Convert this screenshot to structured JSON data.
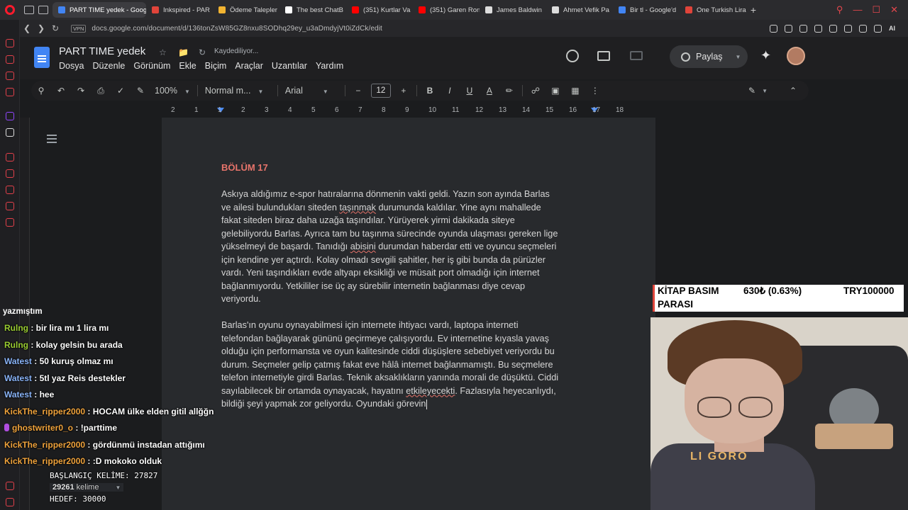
{
  "browser": {
    "tabs": [
      {
        "title": "PART TIME yedek - Google",
        "active": true,
        "color": "#4285f4"
      },
      {
        "title": "Inkspired - PAR",
        "color": "#e0443a"
      },
      {
        "title": "Ödeme Talepler",
        "color": "#f2b431"
      },
      {
        "title": "The best ChatB",
        "color": "#ffffff"
      },
      {
        "title": "(351) Kurtlar Va",
        "color": "#ff0000"
      },
      {
        "title": "(351) Garen Ron",
        "color": "#ff0000"
      },
      {
        "title": "James Baldwin",
        "color": "#dddddd"
      },
      {
        "title": "Ahmet Vefik Pa",
        "color": "#dddddd"
      },
      {
        "title": "Bir tl - Google'd",
        "color": "#4285f4"
      },
      {
        "title": "One Turkish Lira",
        "color": "#e0443a"
      }
    ],
    "new_tab_label": "+",
    "vpn_label": "VPN",
    "url": "docs.google.com/document/d/136tonZsW85GZ8nxu8SODhq29ey_u3aDmdyjVt0iZdCk/edit",
    "ai_label": "AI"
  },
  "docs": {
    "title": "PART TIME  yedek",
    "saving": "Kaydediliyor...",
    "menu": [
      "Dosya",
      "Düzenle",
      "Görünüm",
      "Ekle",
      "Biçim",
      "Araçlar",
      "Uzantılar",
      "Yardım"
    ],
    "share_label": "Paylaş",
    "toolbar": {
      "zoom": "100%",
      "style": "Normal m...",
      "font": "Arial",
      "font_size": "12"
    },
    "ruler_ticks": [
      "2",
      "1",
      "1",
      "2",
      "3",
      "4",
      "5",
      "6",
      "7",
      "8",
      "9",
      "10",
      "11",
      "12",
      "13",
      "14",
      "15",
      "16",
      "17",
      "18"
    ]
  },
  "document": {
    "chapter": "BÖLÜM 17",
    "para1": [
      [
        "Askıya aldığımız e-spor hatıralarına dönmenin vakti geldi. Yazın son ayında Barlas"
      ],
      [
        "ve ailesi bulundukları siteden ",
        {
          "sq": "taşınmak"
        },
        " durumunda kaldılar. Yine aynı mahallede"
      ],
      [
        "fakat siteden biraz daha uzağa taşındılar. Yürüyerek yirmi dakikada siteye"
      ],
      [
        "gelebiliyordu Barlas. Ayrıca tam bu taşınma sürecinde oyunda ulaşması gereken lige"
      ],
      [
        "yükselmeyi de başardı. Tanıdığı ",
        {
          "sq": "abisini"
        },
        " durumdan haberdar etti ve oyuncu seçmeleri"
      ],
      [
        "için kendine yer açtırdı. Kolay olmadı sevgili şahitler, her iş gibi bunda da pürüzler"
      ],
      [
        "vardı. Yeni taşındıkları evde altyapı eksikliği ve müsait port olmadığı için internet"
      ],
      [
        "bağlanmıyordu. Yetkililer ise üç ay sürebilir internetin bağlanması diye cevap"
      ],
      [
        "veriyordu."
      ]
    ],
    "para2": [
      [
        "Barlas'ın oyunu oynayabilmesi için internete ihtiyacı vardı, laptopa interneti"
      ],
      [
        "telefondan bağlayarak gününü geçirmeye çalışıyordu. Ev internetine kıyasla yavaş"
      ],
      [
        "olduğu için performansta ve oyun kalitesinde ciddi düşüşlere sebebiyet veriyordu bu"
      ],
      [
        "durum. Seçmeler gelip çatmış fakat eve hâlâ internet bağlanmamıştı. Bu seçmelere"
      ],
      [
        "telefon internetiyle girdi Barlas. Teknik aksaklıkların yanında morali de düşüktü. Ciddi"
      ],
      [
        "sayılabilecek bir ortamda oynayacak, hayatını ",
        {
          "sq": "etkileyecekti"
        },
        ". Fazlasıyla heyecanlıydı,"
      ],
      [
        "bildiği şeyi yapmak zor geliyordu. Oyundaki görevin"
      ]
    ]
  },
  "chat": {
    "first_line": "yazmıştım",
    "messages": [
      {
        "user": "Rulng",
        "color": "#9acd32",
        "text": ": bir lira mı 1 lira mı"
      },
      {
        "user": "Rulng",
        "color": "#9acd32",
        "text": ": kolay gelsin bu arada"
      },
      {
        "user": "Watest",
        "color": "#8ab4f8",
        "text": ": 50 kuruş olmaz mı"
      },
      {
        "user": "Watest",
        "color": "#8ab4f8",
        "text": ": 5tl yaz Reis destekler"
      },
      {
        "user": "Watest",
        "color": "#8ab4f8",
        "text": ": hee"
      },
      {
        "user": "KickThe_ripper2000",
        "color": "#f0a33c",
        "text": ": HOCAM ülke elden gitil allğğn"
      },
      {
        "user": "ghostwriter0_o",
        "color": "#f0a33c",
        "text": ": !parttime",
        "badge": true
      },
      {
        "user": "KickThe_ripper2000",
        "color": "#f0a33c",
        "text": ": gördünmü instadan attığımı"
      },
      {
        "user": "KickThe_ripper2000",
        "color": "#f0a33c",
        "text": ": :D mokoko olduk"
      }
    ]
  },
  "wordcount": {
    "start_label": "BAŞLANGIÇ KELİME: 27827",
    "count": "29261",
    "count_unit": "kelime",
    "target_label": "HEDEF: 30000"
  },
  "ticker": {
    "name_line1": "KİTAP BASIM",
    "name_line2": "PARASI",
    "value": "630₺ (0.63%)",
    "target": "TRY100000"
  },
  "webcam": {
    "shirt_text": "LI GORO"
  }
}
